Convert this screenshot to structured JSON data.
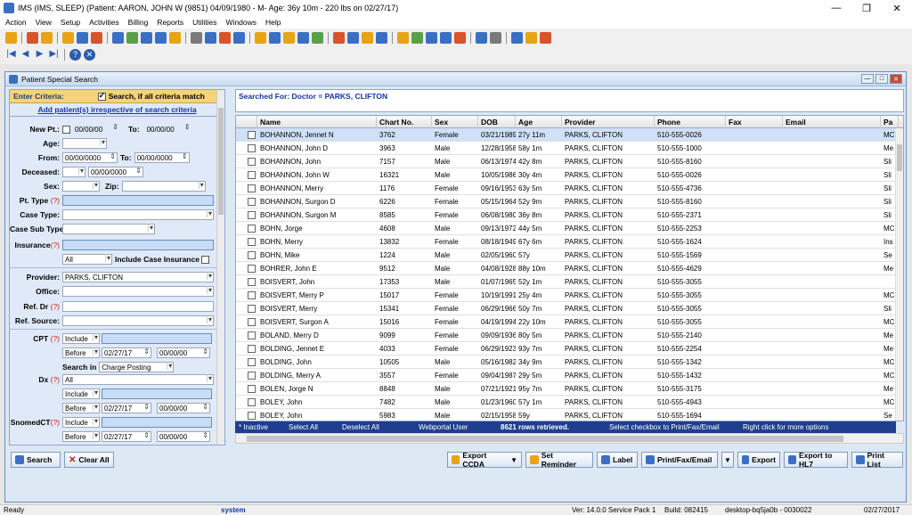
{
  "window": {
    "title": "IMS (IMS, SLEEP)    (Patient: AARON, JOHN W (9851) 04/09/1980 - M- Age: 36y 10m - 220 lbs on 02/27/17)",
    "min_glyph": "—",
    "max_glyph": "❐",
    "close_glyph": "✕"
  },
  "menu": [
    "Action",
    "View",
    "Setup",
    "Activities",
    "Billing",
    "Reports",
    "Utilities",
    "Windows",
    "Help"
  ],
  "toolbar_colors": [
    "#e8a317",
    "#d9532b",
    "#e8a317",
    "#e8a317",
    "#3a6fc4",
    "#d9532b",
    "#3a6fc4",
    "#5aa04a",
    "#3a6fc4",
    "#3a6fc4",
    "#e8a317",
    "#7a7a7a",
    "#3a6fc4",
    "#d9532b",
    "#3a6fc4",
    "#e8a317",
    "#3a6fc4",
    "#e8a317",
    "#3a6fc4",
    "#5aa04a",
    "#d9532b",
    "#3a6fc4",
    "#e8a317",
    "#3a6fc4",
    "#e8a317",
    "#5aa04a",
    "#3a6fc4",
    "#3a6fc4",
    "#d9532b",
    "#3a6fc4",
    "#7a7a7a",
    "#3a6fc4",
    "#e8a317",
    "#d9532b"
  ],
  "child": {
    "title": "Patient Special Search",
    "min_glyph": "—",
    "max_glyph": "□",
    "close_glyph": "✕"
  },
  "criteria": {
    "header": "Enter Criteria:",
    "all_match_label": "Search, if all criteria match",
    "add_link": "Add patient(s) irrespective of search criteria",
    "new_pt_label": "New Pt.:",
    "new_pt_from": "00/00/00",
    "to_label": "To:",
    "new_pt_to": "00/00/00",
    "age_label": "Age:",
    "from_label": "From:",
    "from_value": "00/00/0000",
    "to_value": "00/00/0000",
    "deceased_label": "Deceased:",
    "deceased_date": "00/00/0000",
    "sex_label": "Sex:",
    "zip_label": "Zip:",
    "pt_type_label": "Pt. Type",
    "case_type_label": "Case Type:",
    "case_sub_type_label": "Case Sub Type:",
    "insurance_label": "Insurance",
    "insurance_scope": "All",
    "include_case_ins_label": "Include Case Insurance",
    "provider_label": "Provider:",
    "provider_value": "PARKS, CLIFTON",
    "office_label": "Office:",
    "ref_dr_label": "Ref. Dr",
    "ref_source_label": "Ref. Source:",
    "cpt_label": "CPT",
    "cpt_include": "Include",
    "cpt_before": "Before",
    "cpt_date1": "02/27/17",
    "cpt_date2": "00/00/00",
    "search_in_label": "Search in",
    "search_in_value": "Charge Posting",
    "dx_label": "Dx",
    "dx_all": "All",
    "dx_include": "Include",
    "dx_before": "Before",
    "dx_date1": "02/27/17",
    "dx_date2": "00/00/00",
    "snomed_label": "SnomedCT",
    "snomed_include": "Include",
    "snomed_before": "Before",
    "snomed_date1": "02/27/17",
    "snomed_date2": "00/00/00",
    "q": "(?)"
  },
  "searched_for": "Searched For:  Doctor = PARKS, CLIFTON",
  "grid": {
    "columns": [
      "Name",
      "Chart No.",
      "Sex",
      "DOB",
      "Age",
      "Provider",
      "Phone",
      "Fax",
      "Email",
      "Pa"
    ],
    "rows": [
      [
        "BOHANNON, Jennet N",
        "3762",
        "Female",
        "03/21/1989",
        "27y 11m",
        "PARKS, CLIFTON",
        "510-555-0026",
        "",
        "",
        "MC"
      ],
      [
        "BOHANNON, John D",
        "3963",
        "Male",
        "12/28/1958",
        "58y 1m",
        "PARKS, CLIFTON",
        "510-555-1000",
        "",
        "",
        "Me"
      ],
      [
        "BOHANNON, John",
        "7157",
        "Male",
        "06/13/1974",
        "42y 8m",
        "PARKS, CLIFTON",
        "510-555-8160",
        "",
        "",
        "Sli"
      ],
      [
        "BOHANNON, John W",
        "16321",
        "Male",
        "10/05/1986",
        "30y 4m",
        "PARKS, CLIFTON",
        "510-555-0026",
        "",
        "",
        "Sli"
      ],
      [
        "BOHANNON, Merry",
        "1176",
        "Female",
        "09/16/1953",
        "63y 5m",
        "PARKS, CLIFTON",
        "510-555-4736",
        "",
        "",
        "Sli"
      ],
      [
        "BOHANNON, Surgon D",
        "6226",
        "Female",
        "05/15/1964",
        "52y 9m",
        "PARKS, CLIFTON",
        "510-555-8160",
        "",
        "",
        "Sli"
      ],
      [
        "BOHANNON, Surgon M",
        "8585",
        "Female",
        "06/08/1980",
        "36y 8m",
        "PARKS, CLIFTON",
        "510-555-2371",
        "",
        "",
        "Sli"
      ],
      [
        "BOHN, Jorge",
        "4608",
        "Male",
        "09/13/1972",
        "44y 5m",
        "PARKS, CLIFTON",
        "510-555-2253",
        "",
        "",
        "MC"
      ],
      [
        "BOHN, Merry",
        "13832",
        "Female",
        "08/18/1949",
        "67y 6m",
        "PARKS, CLIFTON",
        "510-555-1624",
        "",
        "",
        "Ins"
      ],
      [
        "BOHN, Mike",
        "1224",
        "Male",
        "02/05/1960",
        "57y",
        "PARKS, CLIFTON",
        "510-555-1569",
        "",
        "",
        "Se"
      ],
      [
        "BOHRER, John E",
        "9512",
        "Male",
        "04/08/1928",
        "88y 10m",
        "PARKS, CLIFTON",
        "510-555-4629",
        "",
        "",
        "Me"
      ],
      [
        "BOISVERT, John",
        "17353",
        "Male",
        "01/07/1965",
        "52y 1m",
        "PARKS, CLIFTON",
        "510-555-3055",
        "",
        "",
        ""
      ],
      [
        "BOISVERT, Merry P",
        "15017",
        "Female",
        "10/19/1991",
        "25y 4m",
        "PARKS, CLIFTON",
        "510-555-3055",
        "",
        "",
        "MC"
      ],
      [
        "BOISVERT, Merry",
        "15341",
        "Female",
        "06/29/1966",
        "50y 7m",
        "PARKS, CLIFTON",
        "510-555-3055",
        "",
        "",
        "Sli"
      ],
      [
        "BOISVERT, Surgon A",
        "15016",
        "Female",
        "04/19/1994",
        "22y 10m",
        "PARKS, CLIFTON",
        "510-555-3055",
        "",
        "",
        "MC"
      ],
      [
        "BOLAND, Merry D",
        "9099",
        "Female",
        "09/09/1936",
        "80y 5m",
        "PARKS, CLIFTON",
        "510-555-2140",
        "",
        "",
        "Me"
      ],
      [
        "BOLDING, Jennet E",
        "4033",
        "Female",
        "06/29/1923",
        "93y 7m",
        "PARKS, CLIFTON",
        "510-555-2254",
        "",
        "",
        "Me"
      ],
      [
        "BOLDING, John",
        "10505",
        "Male",
        "05/16/1982",
        "34y 9m",
        "PARKS, CLIFTON",
        "510-555-1342",
        "",
        "",
        "MC"
      ],
      [
        "BOLDING, Merry A",
        "3557",
        "Female",
        "09/04/1987",
        "29y 5m",
        "PARKS, CLIFTON",
        "510-555-1432",
        "",
        "",
        "MC"
      ],
      [
        "BOLEN, Jorge N",
        "8848",
        "Male",
        "07/21/1921",
        "95y 7m",
        "PARKS, CLIFTON",
        "510-555-3175",
        "",
        "",
        "Me"
      ],
      [
        "BOLEY, John",
        "7482",
        "Male",
        "01/23/1960",
        "57y 1m",
        "PARKS, CLIFTON",
        "510-555-4943",
        "",
        "",
        "MC"
      ],
      [
        "BOLEY, John",
        "5983",
        "Male",
        "02/15/1958",
        "59y",
        "PARKS, CLIFTON",
        "510-555-1694",
        "",
        "",
        "Se"
      ]
    ]
  },
  "gridstatus": {
    "inactive": "* Inactive",
    "select_all": "Select All",
    "deselect_all": "Deselect All",
    "webportal": "Webportal User",
    "rows": "8621 rows retrieved.",
    "hint1": "Select checkbox to Print/Fax/Email",
    "hint2": "Right click for more options"
  },
  "buttons": {
    "search": "Search",
    "clear_all": "Clear All",
    "export_ccda": "Export CCDA",
    "set_reminder": "Set Reminder",
    "label": "Label",
    "print_fax_email": "Print/Fax/Email",
    "export": "Export",
    "export_hl7": "Export to HL7",
    "print_list": "Print List"
  },
  "statusbar": {
    "ready": "Ready",
    "user": "system",
    "version": "Ver: 14.0.0 Service Pack 1",
    "build": "Build: 082415",
    "machine": "desktop-bq5ja0b - 0030022",
    "date": "02/27/2017"
  }
}
